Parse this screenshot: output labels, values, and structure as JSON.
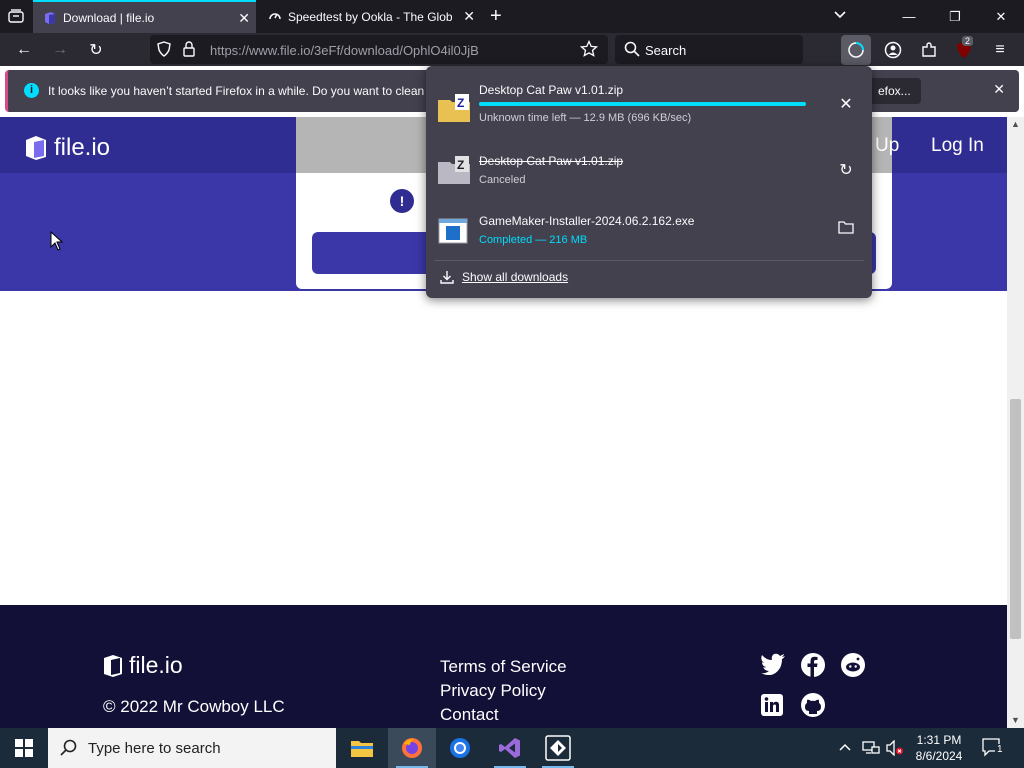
{
  "browser": {
    "tabs": [
      {
        "title": "Download | file.io",
        "active": true
      },
      {
        "title": "Speedtest by Ookla - The Global",
        "active": false
      }
    ],
    "url_domain": "https://www.file.io",
    "url_path": "/3eFf/download/OphlO4il0JjB",
    "search_placeholder": "Search",
    "extension_badge": "2",
    "accent_color": "#00ddff"
  },
  "notification": {
    "message": "It looks like you haven’t started Firefox in a while. Do you want to clean it",
    "button_label": "efox..."
  },
  "site": {
    "logo_text": "file.io",
    "nav_signup": "Up",
    "nav_login": "Log In",
    "footer": {
      "logo_text": "file.io",
      "copyright": "© 2022 Mr Cowboy LLC",
      "links": [
        "Terms of Service",
        "Privacy Policy",
        "Contact"
      ],
      "social": [
        "twitter-icon",
        "facebook-icon",
        "reddit-icon",
        "linkedin-icon",
        "github-icon"
      ]
    }
  },
  "downloads": {
    "items": [
      {
        "name": "Desktop Cat Paw v1.01.zip",
        "status": "Unknown time left — 12.9 MB (696 KB/sec)",
        "state": "in-progress",
        "progress": 1.0
      },
      {
        "name": "Desktop Cat Paw v1.01.zip",
        "status": "Canceled",
        "state": "canceled"
      },
      {
        "name": "GameMaker-Installer-2024.06.2.162.exe",
        "status": "Completed — 216 MB",
        "state": "completed"
      }
    ],
    "show_all_label": "Show all downloads"
  },
  "taskbar": {
    "search_placeholder": "Type here to search",
    "time": "1:31 PM",
    "date": "8/6/2024",
    "notification_count": "1"
  }
}
